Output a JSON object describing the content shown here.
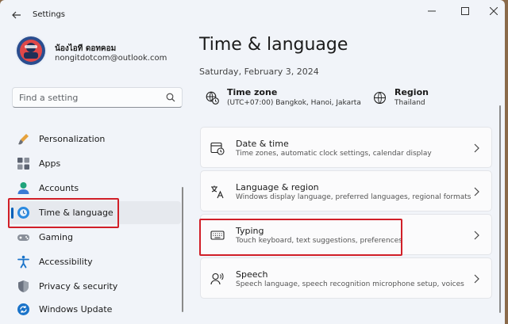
{
  "window": {
    "title": "Settings"
  },
  "user": {
    "name": "น้องไอที ดอทคอม",
    "email": "nongitdotcom@outlook.com"
  },
  "search": {
    "placeholder": "Find a setting"
  },
  "sidebar": {
    "items": [
      {
        "label": "Personalization",
        "icon": "brush-icon"
      },
      {
        "label": "Apps",
        "icon": "apps-icon"
      },
      {
        "label": "Accounts",
        "icon": "person-icon"
      },
      {
        "label": "Time & language",
        "icon": "globe-clock-icon",
        "selected": true
      },
      {
        "label": "Gaming",
        "icon": "gamepad-icon"
      },
      {
        "label": "Accessibility",
        "icon": "accessibility-icon"
      },
      {
        "label": "Privacy & security",
        "icon": "shield-icon"
      },
      {
        "label": "Windows Update",
        "icon": "update-icon"
      }
    ]
  },
  "main": {
    "title": "Time & language",
    "date": "Saturday, February 3, 2024",
    "timezone": {
      "label": "Time zone",
      "value": "(UTC+07:00) Bangkok, Hanoi, Jakarta"
    },
    "region": {
      "label": "Region",
      "value": "Thailand"
    },
    "cards": [
      {
        "title": "Date & time",
        "subtitle": "Time zones, automatic clock settings, calendar display",
        "icon": "calendar-clock-icon"
      },
      {
        "title": "Language & region",
        "subtitle": "Windows display language, preferred languages, regional formats",
        "icon": "language-icon"
      },
      {
        "title": "Typing",
        "subtitle": "Touch keyboard, text suggestions, preferences",
        "icon": "keyboard-icon"
      },
      {
        "title": "Speech",
        "subtitle": "Speech language, speech recognition microphone setup, voices",
        "icon": "speech-icon"
      }
    ]
  },
  "colors": {
    "accent": "#005fb8",
    "highlight": "#d11f28",
    "background": "#f1f4f9"
  }
}
